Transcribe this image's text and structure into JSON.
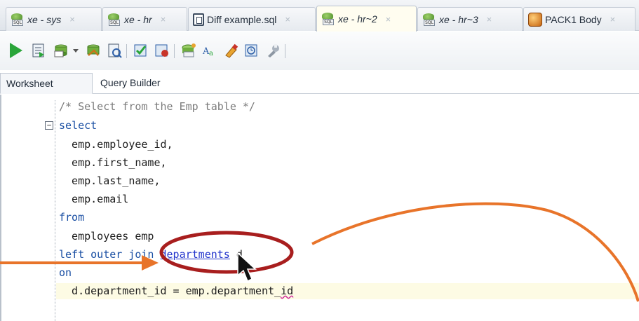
{
  "tabs": [
    {
      "label": "xe - sys",
      "icon": "sql-connection-icon",
      "active": false
    },
    {
      "label": "xe - hr",
      "icon": "sql-connection-icon",
      "active": false
    },
    {
      "label": "Diff example.sql",
      "icon": "sql-file-icon",
      "active": false
    },
    {
      "label": "xe - hr~2",
      "icon": "sql-connection-icon",
      "active": true
    },
    {
      "label": "xe - hr~3",
      "icon": "sql-connection-icon",
      "active": false
    },
    {
      "label": "PACK1 Body",
      "icon": "package-body-icon",
      "active": false
    }
  ],
  "tab_icon_text": "SQL",
  "close_glyph": "×",
  "subtabs": [
    "Worksheet",
    "Query Builder"
  ],
  "toolbar": [
    "run-statement-icon",
    "run-script-icon",
    "commit-icon",
    "rollback-icon",
    "autotrace-icon",
    "explain-plan-icon",
    "sql-tuning-icon",
    "format-icon",
    "clear-icon",
    "history-icon",
    "tools-icon"
  ],
  "code": {
    "comment": "/* Select from the Emp table */",
    "select": "select",
    "col1": "  emp.employee_id,",
    "col2": "  emp.first_name,",
    "col3": "  emp.last_name,",
    "col4": "  emp.email",
    "from": "from",
    "employees": "  employees emp",
    "join_kw": "left outer join",
    "join_table": "departments",
    "join_alias": "d",
    "on": "on",
    "cond_prefix": "  d.department_id = emp.department_",
    "cond_suffix": "id"
  },
  "fold_symbol": "⊟",
  "accent": {
    "annotation": "#e8742a",
    "highlight_ellipse": "#a81e1e",
    "active_line": "#fdfbe4"
  }
}
